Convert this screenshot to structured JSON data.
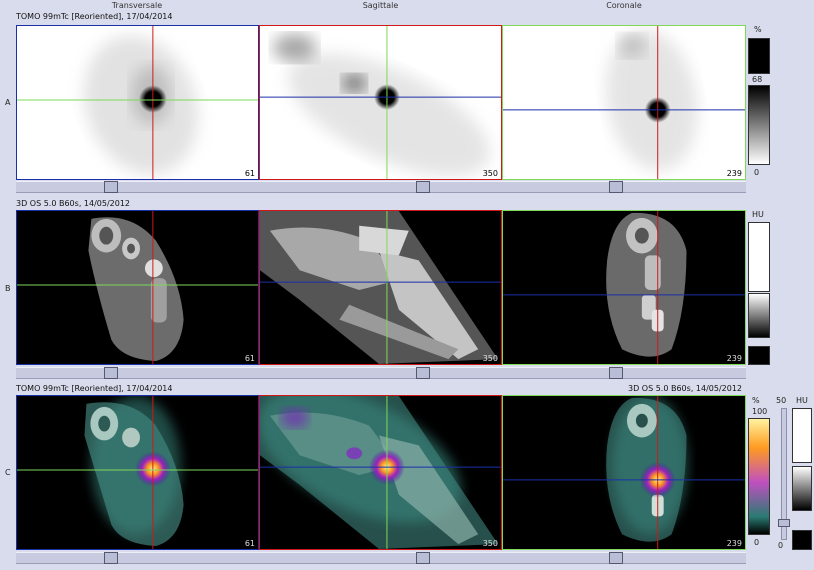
{
  "columns": {
    "transversal": "Transversale",
    "sagittal": "Sagittale",
    "coronal": "Coronale"
  },
  "rows": {
    "a": {
      "letter": "A",
      "title": "TOMO 99mTc [Reoriented], 17/04/2014"
    },
    "b": {
      "letter": "B",
      "title": "3D OS 5.0 B60s, 14/05/2012"
    },
    "c": {
      "letter": "C",
      "title_left": "TOMO 99mTc [Reoriented], 17/04/2014",
      "title_right": "3D OS 5.0 B60s, 14/05/2012"
    }
  },
  "slices": {
    "transversal": "61",
    "sagittal": "350",
    "coronal": "239"
  },
  "colorbars": {
    "a": {
      "unit": "%",
      "max": "68",
      "min": "0"
    },
    "b": {
      "unit": "HU"
    },
    "c": {
      "unit_pct": "%",
      "max_pct": "100",
      "min_pct": "0",
      "fusion": "50",
      "min_fusion": "0",
      "unit_hu": "HU"
    }
  },
  "colors": {
    "crosshair_red": "#d01818",
    "crosshair_green": "#7ed957",
    "crosshair_blue": "#1a2fa8",
    "background": "#d9dcec"
  }
}
